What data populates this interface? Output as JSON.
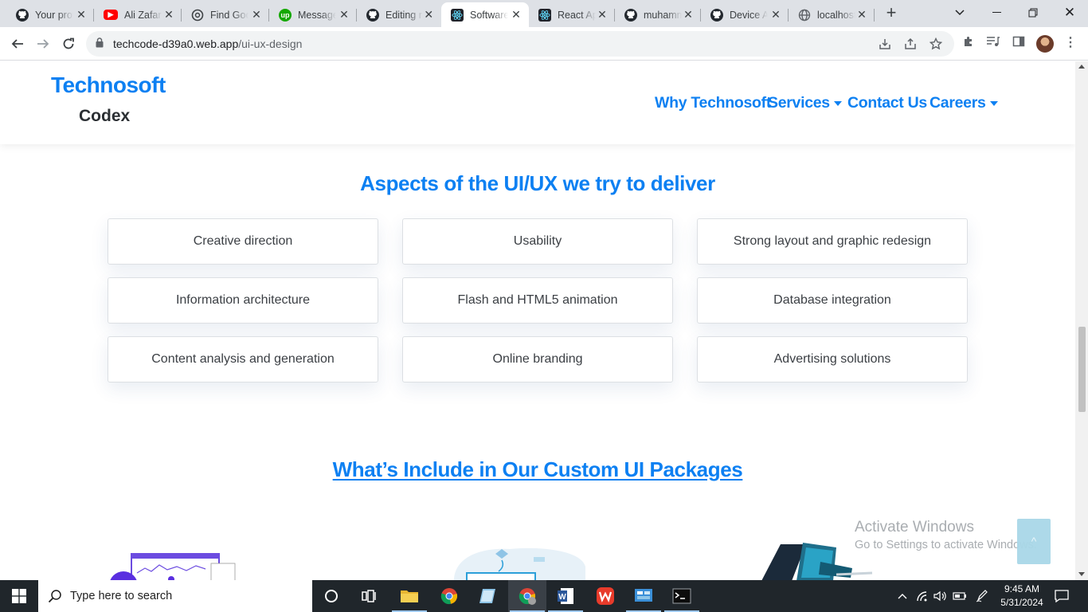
{
  "browser": {
    "tabs": [
      {
        "title": "Your profile",
        "icon": "github-icon",
        "active": false
      },
      {
        "title": "Ali Zafar",
        "icon": "youtube-icon",
        "active": false
      },
      {
        "title": "Find Good",
        "icon": "openai-icon",
        "active": false
      },
      {
        "title": "Messages",
        "icon": "upwork-icon",
        "active": false
      },
      {
        "title": "Editing r",
        "icon": "github-icon",
        "active": false
      },
      {
        "title": "Software",
        "icon": "react-icon",
        "active": true
      },
      {
        "title": "React Ap",
        "icon": "react-icon",
        "active": false
      },
      {
        "title": "muhamm",
        "icon": "github-icon",
        "active": false
      },
      {
        "title": "Device A",
        "icon": "github-icon",
        "active": false
      },
      {
        "title": "localhost",
        "icon": "globe-icon",
        "active": false
      }
    ],
    "address": {
      "host": "techcode-d39a0.web.app",
      "path": "/ui-ux-design"
    }
  },
  "site": {
    "logo_line1": "Technosoft",
    "logo_line2": "Codex",
    "nav": [
      {
        "label": "Why Technosoft",
        "dropdown": false
      },
      {
        "label": "Services",
        "dropdown": true
      },
      {
        "label": "Contact Us",
        "dropdown": false
      },
      {
        "label": "Careers",
        "dropdown": true
      }
    ],
    "accent_color": "#0d80f2"
  },
  "aspects": {
    "title": "Aspects of the UI/UX we try to deliver",
    "items": [
      "Creative direction",
      "Usability",
      "Strong layout and graphic redesign",
      "Information architecture",
      "Flash and HTML5 animation",
      "Database integration",
      "Content analysis and generation",
      "Online branding",
      "Advertising solutions"
    ]
  },
  "packages": {
    "title": "What’s Include in Our Custom UI Packages"
  },
  "overlay": {
    "activate_title": "Activate Windows",
    "activate_sub": "Go to Settings to activate Windows.",
    "back_to_top": "^"
  },
  "taskbar": {
    "search_placeholder": "Type here to search",
    "time": "9:45 AM",
    "date": "5/31/2024"
  }
}
